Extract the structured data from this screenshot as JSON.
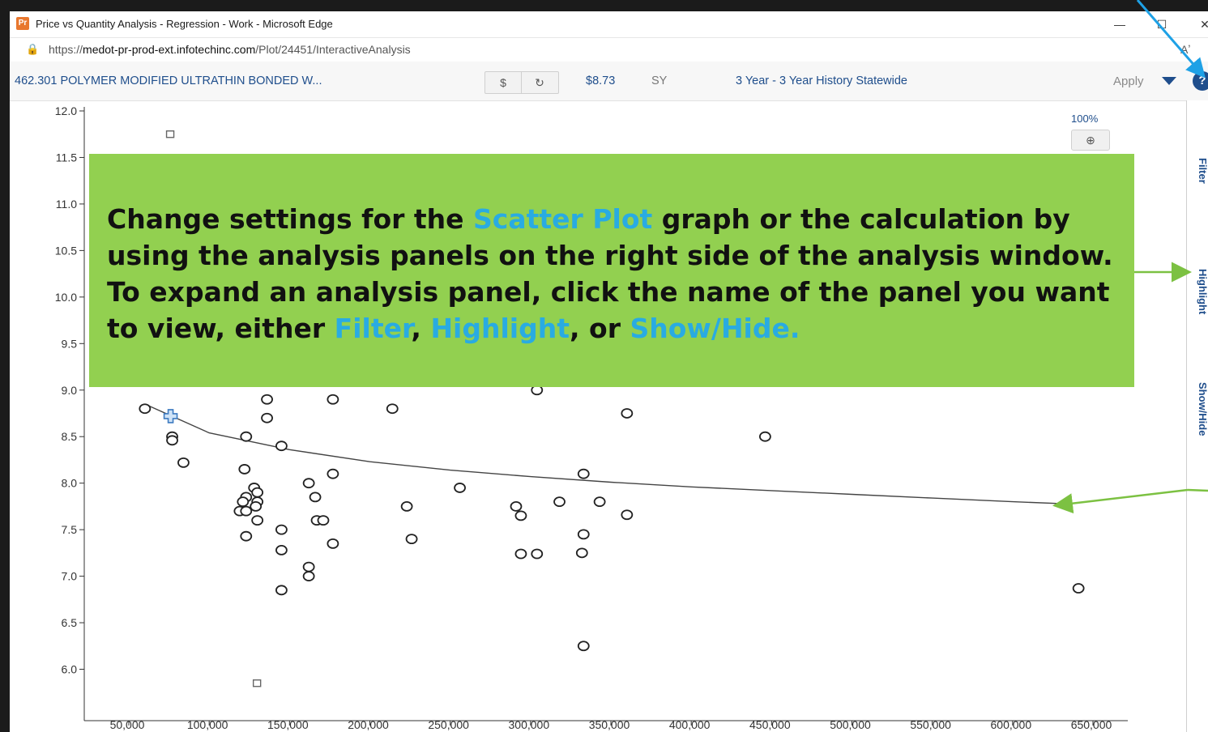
{
  "window": {
    "title": "Price vs Quantity Analysis - Regression - Work - Microsoft Edge",
    "app_icon_text": "Pr",
    "controls": {
      "minimize": "—",
      "maximize": "☐",
      "close": "✕"
    }
  },
  "address": {
    "url_prefix": "https://",
    "url_domain": "medot-pr-prod-ext.infotechinc.com",
    "url_path": "/Plot/24451/InteractiveAnalysis",
    "read_aloud": "Aʼ"
  },
  "toolbar": {
    "item_name": "462.301 POLYMER MODIFIED ULTRATHIN BONDED W...",
    "dollar_label": "$",
    "refresh_label": "↻",
    "price": "$8.73",
    "unit": "SY",
    "history": "3 Year - 3 Year History Statewide",
    "apply_label": "Apply",
    "help_label": "?"
  },
  "zoom": {
    "percent": "100%",
    "zoom_in_label": "⊕"
  },
  "side_tabs": [
    "Filter",
    "Highlight",
    "Show/Hide"
  ],
  "callout": {
    "p1": "Change settings for the ",
    "h1": "Scatter Plot",
    "p2": " graph or the calculation by using the analysis panels on the right side of the analysis window. To expand an analysis panel, click the name of the panel you want to view, either ",
    "h2": "Filter",
    "p3": ", ",
    "h3": "Highlight",
    "p4": ", or ",
    "h4": "Show/Hide."
  },
  "colors": {
    "callout_bg": "#92d050",
    "highlight_text": "#29abe2",
    "link_blue": "#1f4e8c",
    "arrow_green": "#7cc142",
    "arrow_blue": "#1ea1e6"
  },
  "chart_data": {
    "type": "scatter",
    "xlim": [
      30000,
      660000
    ],
    "ylim": [
      5.5,
      12.0
    ],
    "x_ticks": [
      "50,000",
      "100,000",
      "150,000",
      "200,000",
      "250,000",
      "300,000",
      "350,000",
      "400,000",
      "450,000",
      "500,000",
      "550,000",
      "600,000",
      "650,000"
    ],
    "y_ticks": [
      "6.0",
      "6.5",
      "7.0",
      "7.5",
      "8.0",
      "8.5",
      "9.0",
      "9.5",
      "10.0",
      "10.5",
      "11.0",
      "11.5",
      "12.0"
    ],
    "points": [
      [
        60000,
        8.8
      ],
      [
        77000,
        8.5
      ],
      [
        77000,
        8.46
      ],
      [
        84000,
        8.22
      ],
      [
        123000,
        8.5
      ],
      [
        122000,
        8.15
      ],
      [
        123000,
        7.85
      ],
      [
        121000,
        7.8
      ],
      [
        119000,
        7.7
      ],
      [
        123000,
        7.7
      ],
      [
        123000,
        7.43
      ],
      [
        128000,
        7.95
      ],
      [
        130000,
        7.9
      ],
      [
        130000,
        7.8
      ],
      [
        129000,
        7.75
      ],
      [
        130000,
        7.6
      ],
      [
        136000,
        8.9
      ],
      [
        136000,
        8.7
      ],
      [
        145000,
        8.4
      ],
      [
        145000,
        7.5
      ],
      [
        145000,
        7.28
      ],
      [
        145000,
        6.85
      ],
      [
        162000,
        8.0
      ],
      [
        162000,
        7.1
      ],
      [
        162000,
        7.0
      ],
      [
        166000,
        7.85
      ],
      [
        167000,
        7.6
      ],
      [
        171000,
        7.6
      ],
      [
        177000,
        8.9
      ],
      [
        177000,
        8.1
      ],
      [
        177000,
        7.35
      ],
      [
        214000,
        8.8
      ],
      [
        223000,
        7.75
      ],
      [
        226000,
        7.4
      ],
      [
        256000,
        7.95
      ],
      [
        291000,
        7.75
      ],
      [
        294000,
        7.65
      ],
      [
        294000,
        7.24
      ],
      [
        304000,
        7.24
      ],
      [
        304000,
        9.0
      ],
      [
        318000,
        7.8
      ],
      [
        333000,
        8.1
      ],
      [
        333000,
        7.45
      ],
      [
        332000,
        7.25
      ],
      [
        333000,
        6.25
      ],
      [
        343000,
        7.8
      ],
      [
        360000,
        8.75
      ],
      [
        360000,
        7.66
      ],
      [
        446000,
        8.5
      ],
      [
        641000,
        6.87
      ]
    ],
    "excluded_points": [
      [
        76000,
        11.75
      ],
      [
        130000,
        5.85
      ]
    ],
    "highlighted_point": [
      76000,
      8.72
    ],
    "trend_line": {
      "x": [
        60000,
        100000,
        150000,
        200000,
        250000,
        300000,
        350000,
        400000,
        450000,
        500000,
        550000,
        600000,
        630000
      ],
      "y": [
        8.85,
        8.54,
        8.36,
        8.23,
        8.14,
        8.07,
        8.01,
        7.96,
        7.92,
        7.88,
        7.84,
        7.8,
        7.78
      ]
    }
  }
}
